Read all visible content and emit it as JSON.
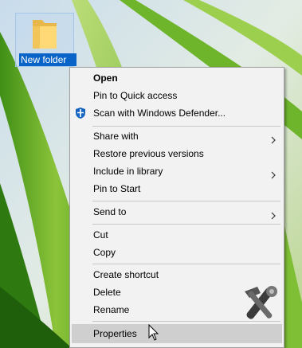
{
  "desktop": {
    "folder_label": "New folder"
  },
  "context_menu": {
    "items": [
      {
        "label": "Open",
        "bold": true
      },
      {
        "label": "Pin to Quick access"
      },
      {
        "label": "Scan with Windows Defender...",
        "icon": "windows-defender-icon"
      },
      {
        "label": "Share with",
        "submenu": true
      },
      {
        "label": "Restore previous versions"
      },
      {
        "label": "Include in library",
        "submenu": true
      },
      {
        "label": "Pin to Start"
      },
      {
        "label": "Send to",
        "submenu": true
      },
      {
        "label": "Cut"
      },
      {
        "label": "Copy"
      },
      {
        "label": "Create shortcut"
      },
      {
        "label": "Delete"
      },
      {
        "label": "Rename"
      },
      {
        "label": "Properties",
        "highlighted": true
      }
    ]
  },
  "colors": {
    "menu_background": "#f2f2f2",
    "highlight": "#cfcfcf",
    "selection": "#0a64c8"
  }
}
